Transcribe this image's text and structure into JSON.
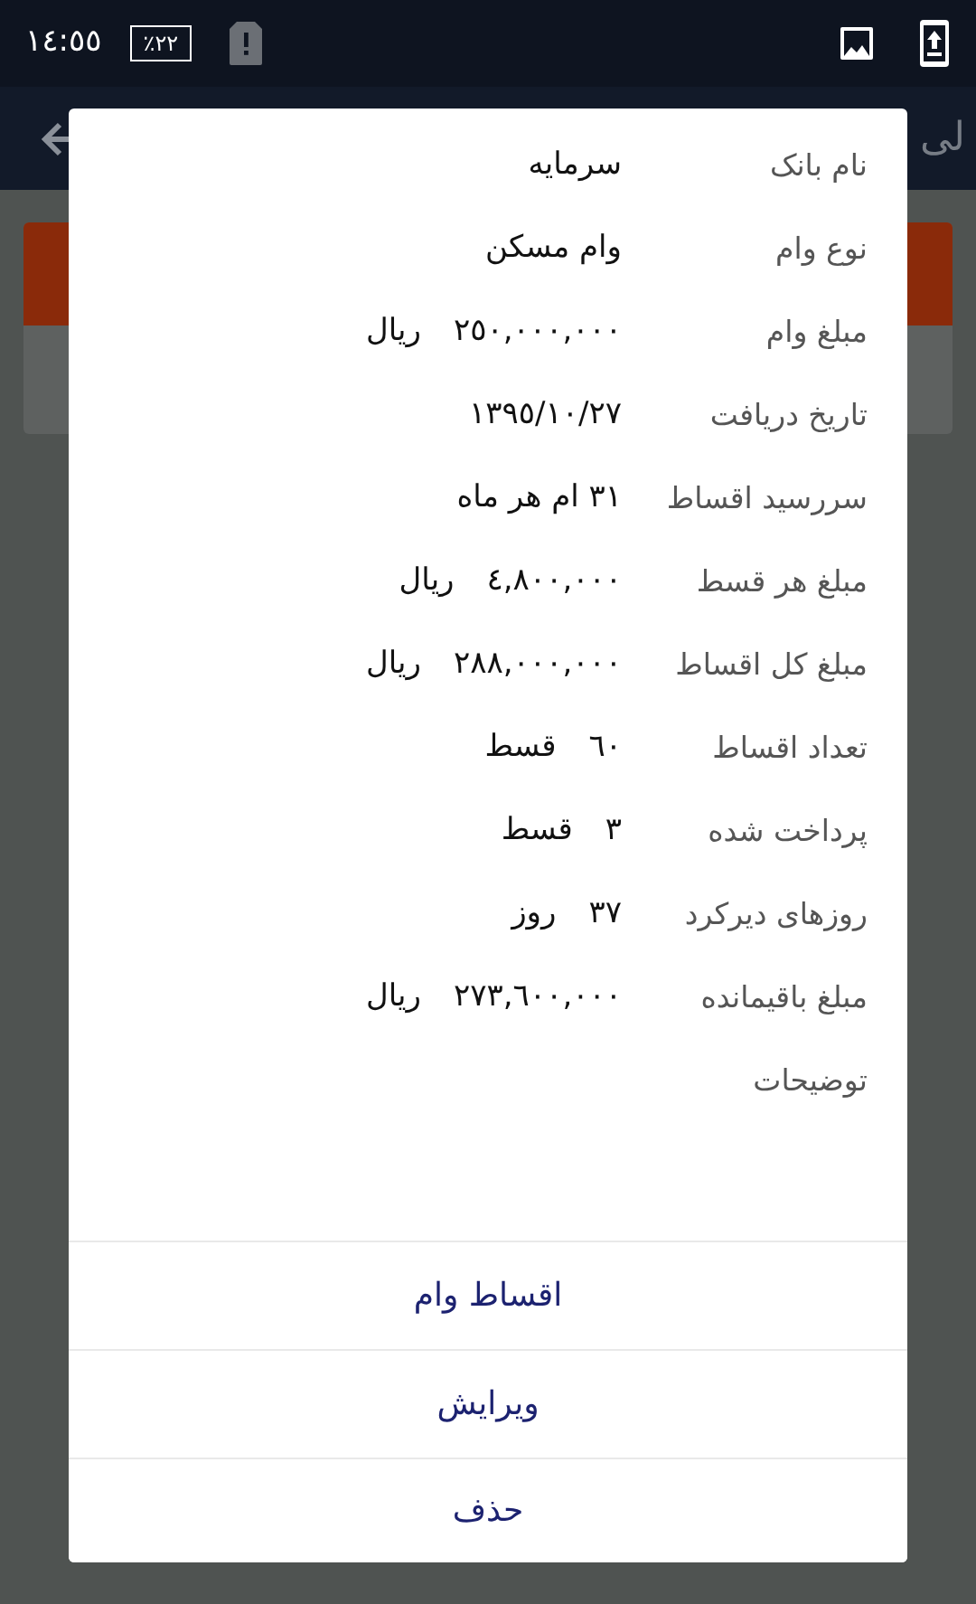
{
  "status_bar": {
    "time": "١٤:٥٥",
    "battery": "٪٢٢"
  },
  "app_bar": {
    "title": "لی"
  },
  "dialog": {
    "rows": [
      {
        "label": "نام بانک",
        "value": "سرمایه"
      },
      {
        "label": "نوع وام",
        "value": "وام مسکن"
      },
      {
        "label": "مبلغ وام",
        "value": "٢٥٠,٠٠٠,٠٠٠",
        "unit": "ریال"
      },
      {
        "label": "تاریخ دریافت",
        "value": "١٣٩٥/١٠/٢٧"
      },
      {
        "label": "سررسید اقساط",
        "value": "٣١ ام هر ماه"
      },
      {
        "label": "مبلغ هر قسط",
        "value": "٤,٨٠٠,٠٠٠",
        "unit": "ریال"
      },
      {
        "label": "مبلغ کل اقساط",
        "value": "٢٨٨,٠٠٠,٠٠٠",
        "unit": "ریال"
      },
      {
        "label": "تعداد اقساط",
        "value": "٦٠",
        "unit": "قسط"
      },
      {
        "label": "پرداخت شده",
        "value": "٣",
        "unit": "قسط"
      },
      {
        "label": "روزهای دیرکرد",
        "value": "٣٧",
        "unit": "روز"
      },
      {
        "label": "مبلغ باقیمانده",
        "value": "٢٧٣,٦٠٠,٠٠٠",
        "unit": "ریال"
      },
      {
        "label": "توضیحات"
      }
    ],
    "actions": [
      "اقساط وام",
      "ویرایش",
      "حذف"
    ]
  }
}
